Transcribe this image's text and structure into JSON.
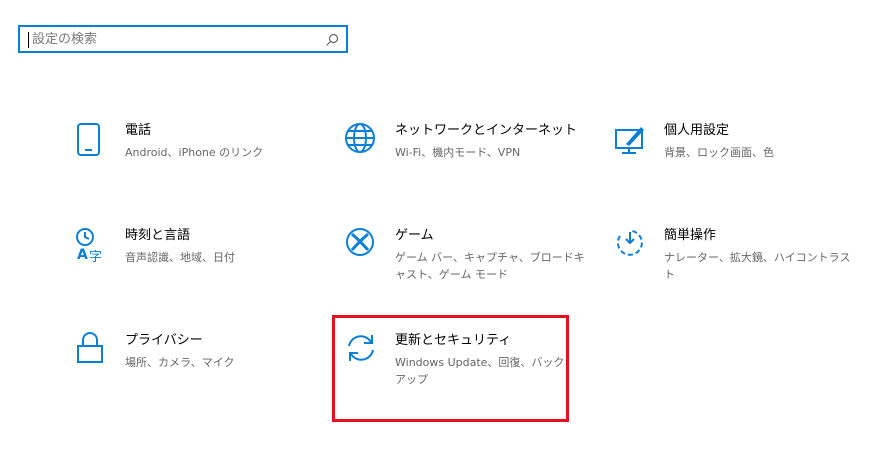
{
  "search": {
    "placeholder": "設定の検索"
  },
  "tiles": {
    "phone": {
      "title": "電話",
      "desc": "Android、iPhone のリンク",
      "icon": "phone-icon"
    },
    "network": {
      "title": "ネットワークとインターネット",
      "desc": "Wi-Fi、機内モード、VPN",
      "icon": "globe-icon"
    },
    "personal": {
      "title": "個人用設定",
      "desc": "背景、ロック画面、色",
      "icon": "personalization-icon"
    },
    "time": {
      "title": "時刻と言語",
      "desc": "音声認識、地域、日付",
      "icon": "time-language-icon"
    },
    "gaming": {
      "title": "ゲーム",
      "desc": "ゲーム バー、キャプチャ、ブロードキャスト、ゲーム モード",
      "icon": "xbox-icon"
    },
    "access": {
      "title": "簡単操作",
      "desc": "ナレーター、拡大鏡、ハイコントラスト",
      "icon": "ease-of-access-icon"
    },
    "privacy": {
      "title": "プライバシー",
      "desc": "場所、カメラ、マイク",
      "icon": "lock-icon"
    },
    "update": {
      "title": "更新とセキュリティ",
      "desc": "Windows Update、回復、バックアップ",
      "icon": "sync-icon"
    }
  },
  "colors": {
    "accent": "#0a7fd6",
    "highlight": "#e5121d"
  }
}
